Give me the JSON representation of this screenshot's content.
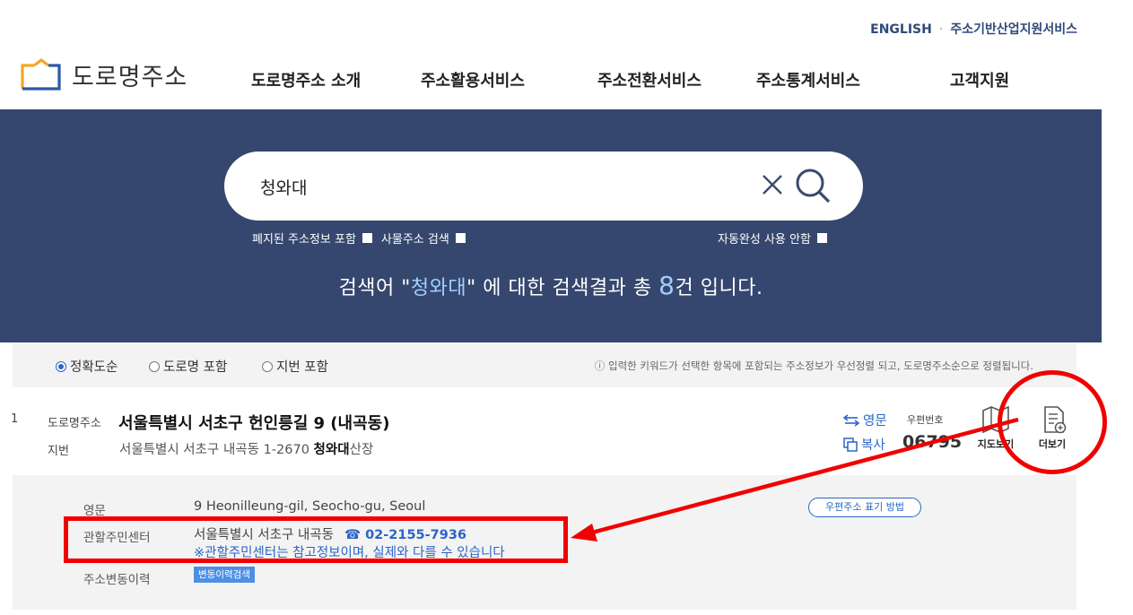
{
  "util_links": {
    "english": "ENGLISH",
    "dot": "·",
    "industry": "주소기반산업지원서비스"
  },
  "logo": {
    "text": "도로명주소",
    "icon": "logo-house-icon"
  },
  "gnb": [
    "도로명주소 소개",
    "주소활용서비스",
    "주소전환서비스",
    "주소통계서비스",
    "고객지원"
  ],
  "search": {
    "value": "청와대",
    "options": {
      "abolished": "폐지된 주소정보 포함",
      "object": "사물주소 검색",
      "autocomplete": "자동완성 사용 안함"
    },
    "result_prefix": "검색어 \"",
    "keyword": "청와대",
    "result_mid": "\" 에 대한 검색결과 총 ",
    "count": "8",
    "result_suffix": "건 입니다."
  },
  "sort": {
    "options": [
      "정확도순",
      "도로명 포함",
      "지번 포함"
    ],
    "selected": "정확도순",
    "note": "ⓘ 입력한 키워드가 선택한 항목에 포함되는 주소정보가 우선정렬 되고, 도로명주소순으로 정렬됩니다."
  },
  "result": {
    "num": "1",
    "road_label": "도로명주소",
    "road_addr": "서울특별시 서초구 헌인릉길 9 (내곡동)",
    "jibun_label": "지번",
    "jibun_prefix": "서울특별시 서초구 내곡동 1-2670 ",
    "jibun_kw": "청와대",
    "jibun_suffix": "산장",
    "english_btn": "영문",
    "copy_btn": "복사",
    "zip_label": "우편번호",
    "zip_code": "06795",
    "map_btn": "지도보기",
    "more_btn": "더보기"
  },
  "detail": {
    "eng_label": "영문",
    "eng_value": "9 Heonilleung-gil, Seocho-gu, Seoul",
    "center_label": "관할주민센터",
    "center_value": "서울특별시 서초구 내곡동",
    "phone": "☎ 02-2155-7936",
    "center_note": "※관할주민센터는 참고정보이며, 실제와 다를 수 있습니다",
    "history_label": "주소변동이력",
    "history_btn": "변동이력검색",
    "zip_guide": "우편주소 표기 방법"
  },
  "colors": {
    "hero_bg": "#35476e",
    "accent": "#2a66c6",
    "annotation": "#f00000"
  }
}
